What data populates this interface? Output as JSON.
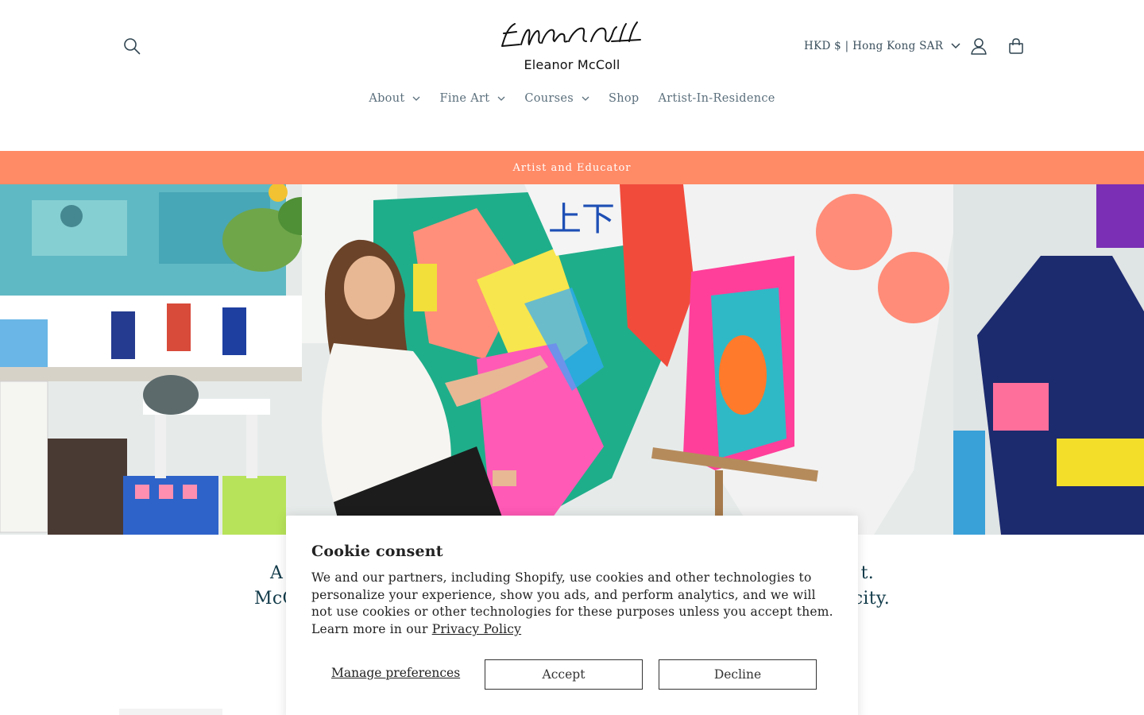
{
  "header": {
    "logo_text": "Eleanor McColl",
    "currency_label": "HKD $ | Hong Kong SAR",
    "icons": {
      "search": "search-icon",
      "account": "account-icon",
      "cart": "cart-icon"
    }
  },
  "nav": {
    "items": [
      {
        "label": "About",
        "has_dropdown": true
      },
      {
        "label": "Fine Art",
        "has_dropdown": true
      },
      {
        "label": "Courses",
        "has_dropdown": true
      },
      {
        "label": "Shop",
        "has_dropdown": false
      },
      {
        "label": "Artist-In-Residence",
        "has_dropdown": false
      }
    ]
  },
  "announcement": {
    "text": "Artist and Educator",
    "color": "#ff8a66"
  },
  "intro": {
    "line1_left": "A",
    "line1_right": "t.",
    "line2_left": "McC",
    "line2_right": "city."
  },
  "cookie": {
    "title": "Cookie consent",
    "body": "We and our partners, including Shopify, use cookies and other technologies to personalize your experience, show you ads, and perform analytics, and we will not use cookies or other technologies for these purposes unless you accept them. Learn more in our ",
    "privacy_link": "Privacy Policy",
    "manage_label": "Manage preferences",
    "accept_label": "Accept",
    "decline_label": "Decline"
  }
}
